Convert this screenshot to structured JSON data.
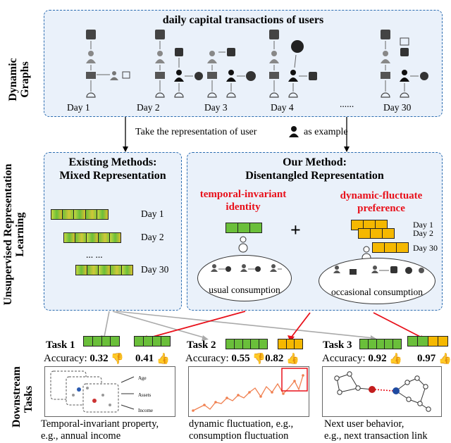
{
  "row_labels": {
    "dynamic": "Dynamic Graphs",
    "unsupervised": "Unsupervised Representation Learning",
    "downstream": "Downstream Tasks"
  },
  "top": {
    "title": "daily capital transactions of users",
    "days": [
      "Day 1",
      "Day 2",
      "Day 3",
      "Day 4",
      "Day 30"
    ],
    "ellipsis": "......",
    "caption_before": "Take the  representation of user",
    "caption_after": "as example"
  },
  "existing": {
    "title_line1": "Existing Methods:",
    "title_line2": "Mixed Representation",
    "days": [
      "Day 1",
      "Day 2",
      "Day 30"
    ],
    "ellipsis": "... ..."
  },
  "ours": {
    "title_line1": "Our Method:",
    "title_line2": "Disentangled Representation",
    "invariant_line1": "temporal-invariant",
    "invariant_line2": "identity",
    "fluctuate_line1": "dynamic-fluctuate",
    "fluctuate_line2": "preference",
    "plus": "+",
    "stack_days": [
      "Day 1",
      "Day 2",
      "Day 30"
    ],
    "stack_ellipsis": ". . .",
    "cloud_left": "usual consumption",
    "cloud_right": "occasional consumption"
  },
  "tasks": [
    {
      "name": "Task 1",
      "acc_label": "Accuracy:",
      "baseline": "0.32",
      "ours": "0.41",
      "desc_line1": "Temporal-invariant property,",
      "desc_line2": "e.g., annual income",
      "panel_items": [
        "Age",
        "Assets",
        "Income"
      ]
    },
    {
      "name": "Task 2",
      "acc_label": "Accuracy:",
      "baseline": "0.55",
      "ours": "0.82",
      "desc_line1": "dynamic fluctuation, e.g.,",
      "desc_line2": "consumption fluctuation"
    },
    {
      "name": "Task 3",
      "acc_label": "Accuracy:",
      "baseline": "0.92",
      "ours": "0.97",
      "desc_line1": "Next user behavior,",
      "desc_line2": "e.g., next transaction link"
    }
  ],
  "colors": {
    "accent_red": "#e8101a",
    "box_border": "#2b6cb0",
    "box_fill": "#eaf1fa",
    "green_vec": "#6abf3a",
    "orange_vec": "#f5b800",
    "arrow_gray": "#aaaaaa"
  }
}
